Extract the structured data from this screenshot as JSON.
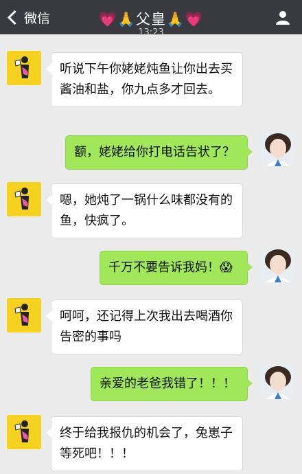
{
  "header": {
    "back_label": "微信",
    "title": "💗🙏父皇🙏💗",
    "time": "13:23"
  },
  "messages": [
    {
      "sender": "dad",
      "text": "听说下午你姥姥炖鱼让你出去买酱油和盐，你九点多才回去。"
    },
    {
      "sender": "me",
      "text": "额，姥姥给你打电话告状了？"
    },
    {
      "sender": "dad",
      "text": "嗯，她炖了一锅什么味都没有的鱼，快疯了。"
    },
    {
      "sender": "me",
      "text": "千万不要告诉我妈！😱"
    },
    {
      "sender": "dad",
      "text": "呵呵，还记得上次我出去喝酒你告密的事吗"
    },
    {
      "sender": "me",
      "text": "亲爱的老爸我错了！！！"
    },
    {
      "sender": "dad",
      "text": "终于给我报仇的机会了，兔崽子等死吧！！！"
    }
  ],
  "colors": {
    "header_bg": "#393a3f",
    "chat_bg": "#ebebeb",
    "my_bubble": "#a0e75a",
    "their_bubble": "#ffffff"
  }
}
